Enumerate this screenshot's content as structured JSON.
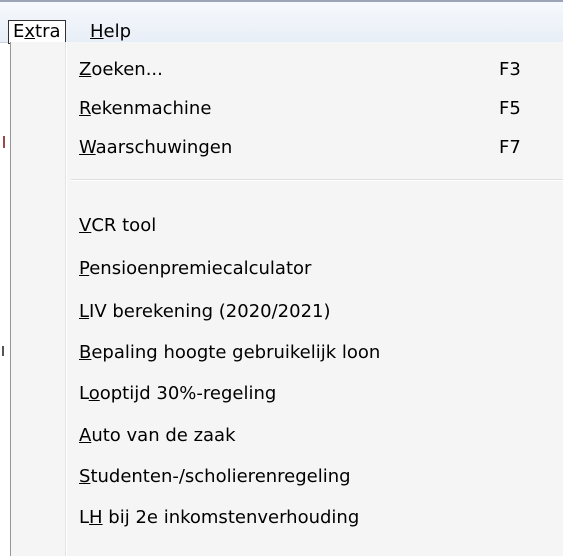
{
  "menubar": {
    "items": [
      {
        "prefix": "E",
        "mnemonic": "x",
        "suffix": "tra",
        "active": true
      },
      {
        "prefix": "",
        "mnemonic": "H",
        "suffix": "elp",
        "active": false
      }
    ]
  },
  "menu": {
    "group1": [
      {
        "mnemonic": "Z",
        "rest": "oeken...",
        "shortcut": "F3"
      },
      {
        "mnemonic": "R",
        "rest": "ekenmachine",
        "shortcut": "F5"
      },
      {
        "mnemonic": "W",
        "rest": "aarschuwingen",
        "shortcut": "F7"
      }
    ],
    "group2": [
      {
        "prefix": "",
        "mnemonic": "V",
        "rest": "CR tool"
      },
      {
        "prefix": "",
        "mnemonic": "P",
        "rest": "ensioenpremiecalculator"
      },
      {
        "prefix": "",
        "mnemonic": "L",
        "rest": "IV berekening (2020/2021)"
      },
      {
        "prefix": "",
        "mnemonic": "B",
        "rest": "epaling hoogte gebruikelijk loon"
      },
      {
        "prefix": "L",
        "mnemonic": "o",
        "rest": "optijd 30%-regeling"
      },
      {
        "prefix": "",
        "mnemonic": "A",
        "rest": "uto van de zaak"
      },
      {
        "prefix": "",
        "mnemonic": "S",
        "rest": "tudenten-/scholierenregeling"
      },
      {
        "prefix": "L",
        "mnemonic": "H",
        "rest": " bij 2e inkomstenverhouding"
      }
    ]
  }
}
